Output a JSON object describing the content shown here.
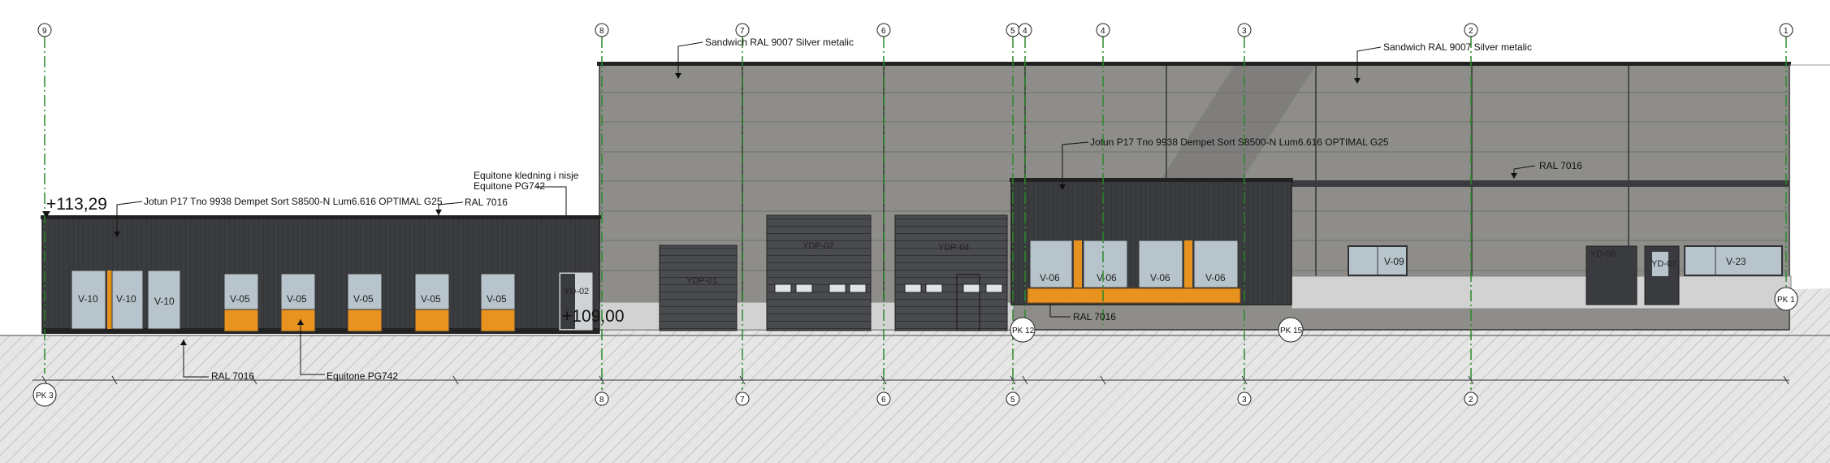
{
  "grid_axes_top": [
    "9",
    "8",
    "7",
    "6",
    "5",
    "4",
    "4",
    "3",
    "2",
    "1"
  ],
  "grid_axes_bottom": [
    "8",
    "7",
    "6",
    "5",
    "3",
    "2"
  ],
  "section_markers": [
    "PK 3",
    "PK 12",
    "PK 15",
    "PK 1"
  ],
  "levels": {
    "top": "+113,29",
    "ground": "+109,00"
  },
  "labels": {
    "sandwich_left": "Sandwich RAL 9007 Silver metalic",
    "sandwich_right": "Sandwich RAL 9007 Silver metalic",
    "jotun_right": "Jotun P17 Tno 9938 Dempet Sort S8500-N Lum6.616 OPTIMAL G25",
    "jotun_left": "Jotun P17 Tno 9938 Dempet Sort S8500-N Lum6.616 OPTIMAL G25",
    "ral_roof_left": "RAL 7016",
    "equitone_line1": "Equitone kledning i nisje",
    "equitone_line2": "Equitone PG742",
    "ral_right": "RAL 7016",
    "ral_bottom_left": "RAL 7016",
    "equitone_bottom": "Equitone PG742",
    "ral_bottom_mid": "RAL 7016"
  },
  "windows": {
    "v10": [
      "V-10",
      "V-10",
      "V-10"
    ],
    "v05": [
      "V-05",
      "V-05",
      "V-05",
      "V-05",
      "V-05"
    ],
    "v06": [
      "V-06",
      "V-06",
      "V-06",
      "V-06"
    ],
    "v09": "V-09",
    "v23": "V-23"
  },
  "doors": {
    "yd02": "YD-02",
    "ydp01": "YDP-01",
    "ydp02": "YDP-02",
    "ydp04": "YDP-04",
    "yd06": "YD-06",
    "yd07": "YD-07",
    "yd": "YD"
  },
  "colors": {
    "dark_cladding": "#3a3b3e",
    "sandwich_panel": "#8e8d8a",
    "accent_orange": "#e8921f",
    "ground_hatch": "#dcdcdc",
    "glass": "#b8c4cc",
    "grid_line": "#2a8a2a"
  }
}
